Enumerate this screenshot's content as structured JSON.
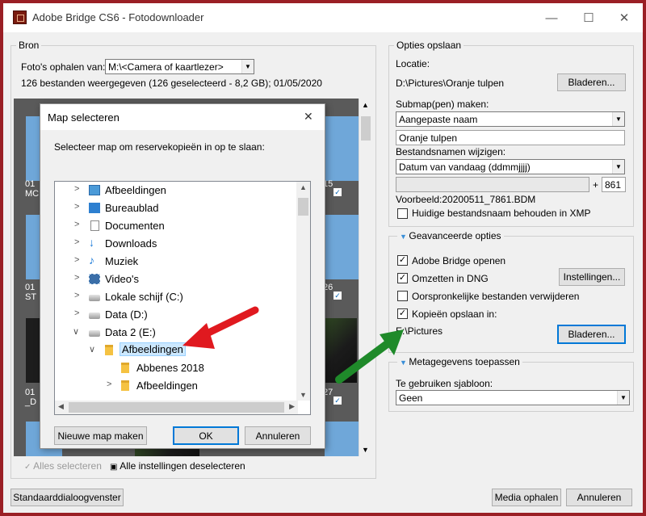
{
  "window": {
    "title": "Adobe Bridge CS6 - Fotodownloader",
    "minimize": "—",
    "maximize": "☐",
    "close": "✕"
  },
  "bron": {
    "title": "Bron",
    "fetch_label": "Foto's ophalen van:",
    "fetch_value": "M:\\<Camera of kaartlezer>",
    "status": "126 bestanden weergegeven (126 geselecteerd - 8,2 GB); 01/05/2020",
    "thumb_labels": [
      "01",
      "MC",
      "01",
      "ST",
      "01",
      "_D",
      "15",
      "26",
      "27"
    ],
    "select_all": "Alles selecteren",
    "deselect_all": "Alle instellingen deselecteren"
  },
  "opslaan": {
    "title": "Opties opslaan",
    "location_label": "Locatie:",
    "location_value": "D:\\Pictures\\Oranje tulpen",
    "browse": "Bladeren...",
    "subfolder_label": "Submap(pen) maken:",
    "subfolder_value": "Aangepaste naam",
    "subfolder_name": "Oranje tulpen",
    "rename_label": "Bestandsnamen wijzigen:",
    "rename_value": "Datum van vandaag (ddmmjjjj)",
    "plus": "+",
    "number": "861",
    "preview": "Voorbeeld:20200511_7861.BDM",
    "keep_name": "Huidige bestandsnaam behouden in XMP"
  },
  "advanced": {
    "title": "Geavanceerde opties",
    "open_bridge": "Adobe Bridge openen",
    "dng": "Omzetten in DNG",
    "settings": "Instellingen...",
    "delete_originals": "Oorspronkelijke bestanden verwijderen",
    "save_copies": "Kopieën opslaan in:",
    "copies_path": "E:\\Pictures",
    "browse": "Bladeren..."
  },
  "meta": {
    "title": "Metagegevens toepassen",
    "template_label": "Te gebruiken sjabloon:",
    "template_value": "Geen"
  },
  "footer": {
    "standard": "Standaarddialoogvenster",
    "fetch": "Media ophalen",
    "cancel": "Annuleren"
  },
  "dialog": {
    "title": "Map selecteren",
    "close": "✕",
    "prompt": "Selecteer map om reservekopieën in op te slaan:",
    "tree": [
      {
        "label": "Afbeeldingen",
        "icon": "pictures-icon"
      },
      {
        "label": "Bureaublad",
        "icon": "desktop-icon"
      },
      {
        "label": "Documenten",
        "icon": "documents-icon"
      },
      {
        "label": "Downloads",
        "icon": "downloads-icon"
      },
      {
        "label": "Muziek",
        "icon": "music-icon"
      },
      {
        "label": "Video's",
        "icon": "videos-icon"
      },
      {
        "label": "Lokale schijf (C:)",
        "icon": "local-disk-icon"
      },
      {
        "label": "Data (D:)",
        "icon": "drive-icon"
      },
      {
        "label": "Data 2 (E:)",
        "icon": "drive-icon"
      },
      {
        "label": "Afbeeldingen",
        "icon": "folder-icon"
      },
      {
        "label": "Abbenes 2018",
        "icon": "folder-icon"
      },
      {
        "label": "Afbeeldingen",
        "icon": "folder-icon"
      }
    ],
    "new_folder": "Nieuwe map maken",
    "ok": "OK",
    "cancel": "Annuleren"
  },
  "colors": {
    "accent": "#0078d7",
    "frame": "#9a1f25",
    "red_arrow": "#e0191f",
    "green_arrow": "#1f8a2a",
    "thumb": "#6fa7d9"
  }
}
